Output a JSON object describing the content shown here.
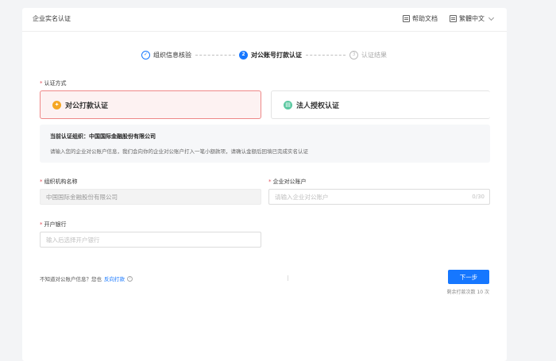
{
  "header": {
    "title": "企业实名认证",
    "help_label": "帮助文档",
    "lang_label": "繁體中文"
  },
  "steps": [
    {
      "label": "组织信息核验",
      "state": "done",
      "marker": "✓"
    },
    {
      "label": "对公账号打款认证",
      "state": "active",
      "marker": "2"
    },
    {
      "label": "认证结果",
      "state": "pending",
      "marker": "3"
    }
  ],
  "form": {
    "method_label": "认证方式",
    "methods": [
      {
        "label": "对公打款认证",
        "selected": true,
        "icon": "lightbulb-icon"
      },
      {
        "label": "法人授权认证",
        "selected": false,
        "icon": "document-icon"
      }
    ],
    "info": {
      "current_org": "当前认证组织：中国国际金融股份有限公司",
      "description": "请输入您的企业对公账户信息，我们会向你的企业对公账户打入一笔小额款项，请确认金额后回填已完成实名认证"
    },
    "org_name_label": "组织机构名称",
    "org_name_value": "中国国际金融股份有限公司",
    "account_label": "企业对公账户",
    "account_placeholder": "请输入企业对公账户",
    "account_count": "0/30",
    "bank_label": "开户银行",
    "bank_placeholder": "输入后选择开户银行"
  },
  "footer": {
    "hint_text": "不知道对公账户信息？您也",
    "hint_link": "反向打款",
    "next_label": "下一步",
    "remaining": "剩余打款次数 10 次"
  },
  "colors": {
    "primary": "#1677ff",
    "required": "#e34d59",
    "selected_bg": "#fdf2f2"
  }
}
